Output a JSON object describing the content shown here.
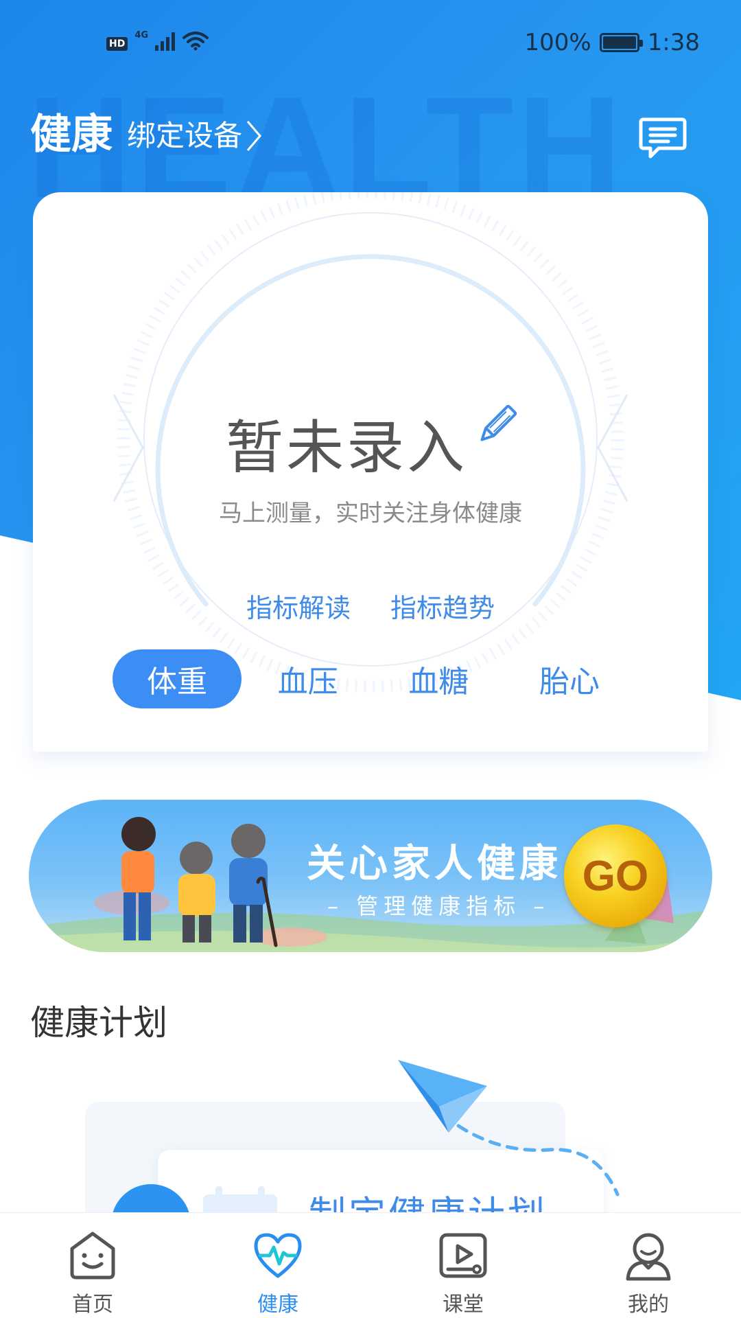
{
  "status_bar": {
    "hd": "HD",
    "network": "4G",
    "battery_percent": "100%",
    "time": "1:38"
  },
  "header": {
    "title": "健康",
    "bind_device": "绑定设备",
    "watermark": "HEALTH"
  },
  "card": {
    "empty_title": "暂未录入",
    "empty_subtitle": "马上测量，实时关注身体健康",
    "links": [
      "指标解读",
      "指标趋势"
    ],
    "tabs": [
      "体重",
      "血压",
      "血糖",
      "胎心"
    ],
    "active_tab": 0
  },
  "banner": {
    "title": "关心家人健康",
    "subtitle": "– 管理健康指标 –",
    "go": "GO"
  },
  "plan": {
    "section_title": "健康计划",
    "card_title": "制定健康计划"
  },
  "bottom_nav": {
    "items": [
      "首页",
      "健康",
      "课堂",
      "我的"
    ],
    "active": 1
  },
  "colors": {
    "brand_blue": "#2796f0",
    "accent_blue": "#3f8be9",
    "active_tab": "#3d8ef4",
    "go_yellow": "#f8d020"
  }
}
